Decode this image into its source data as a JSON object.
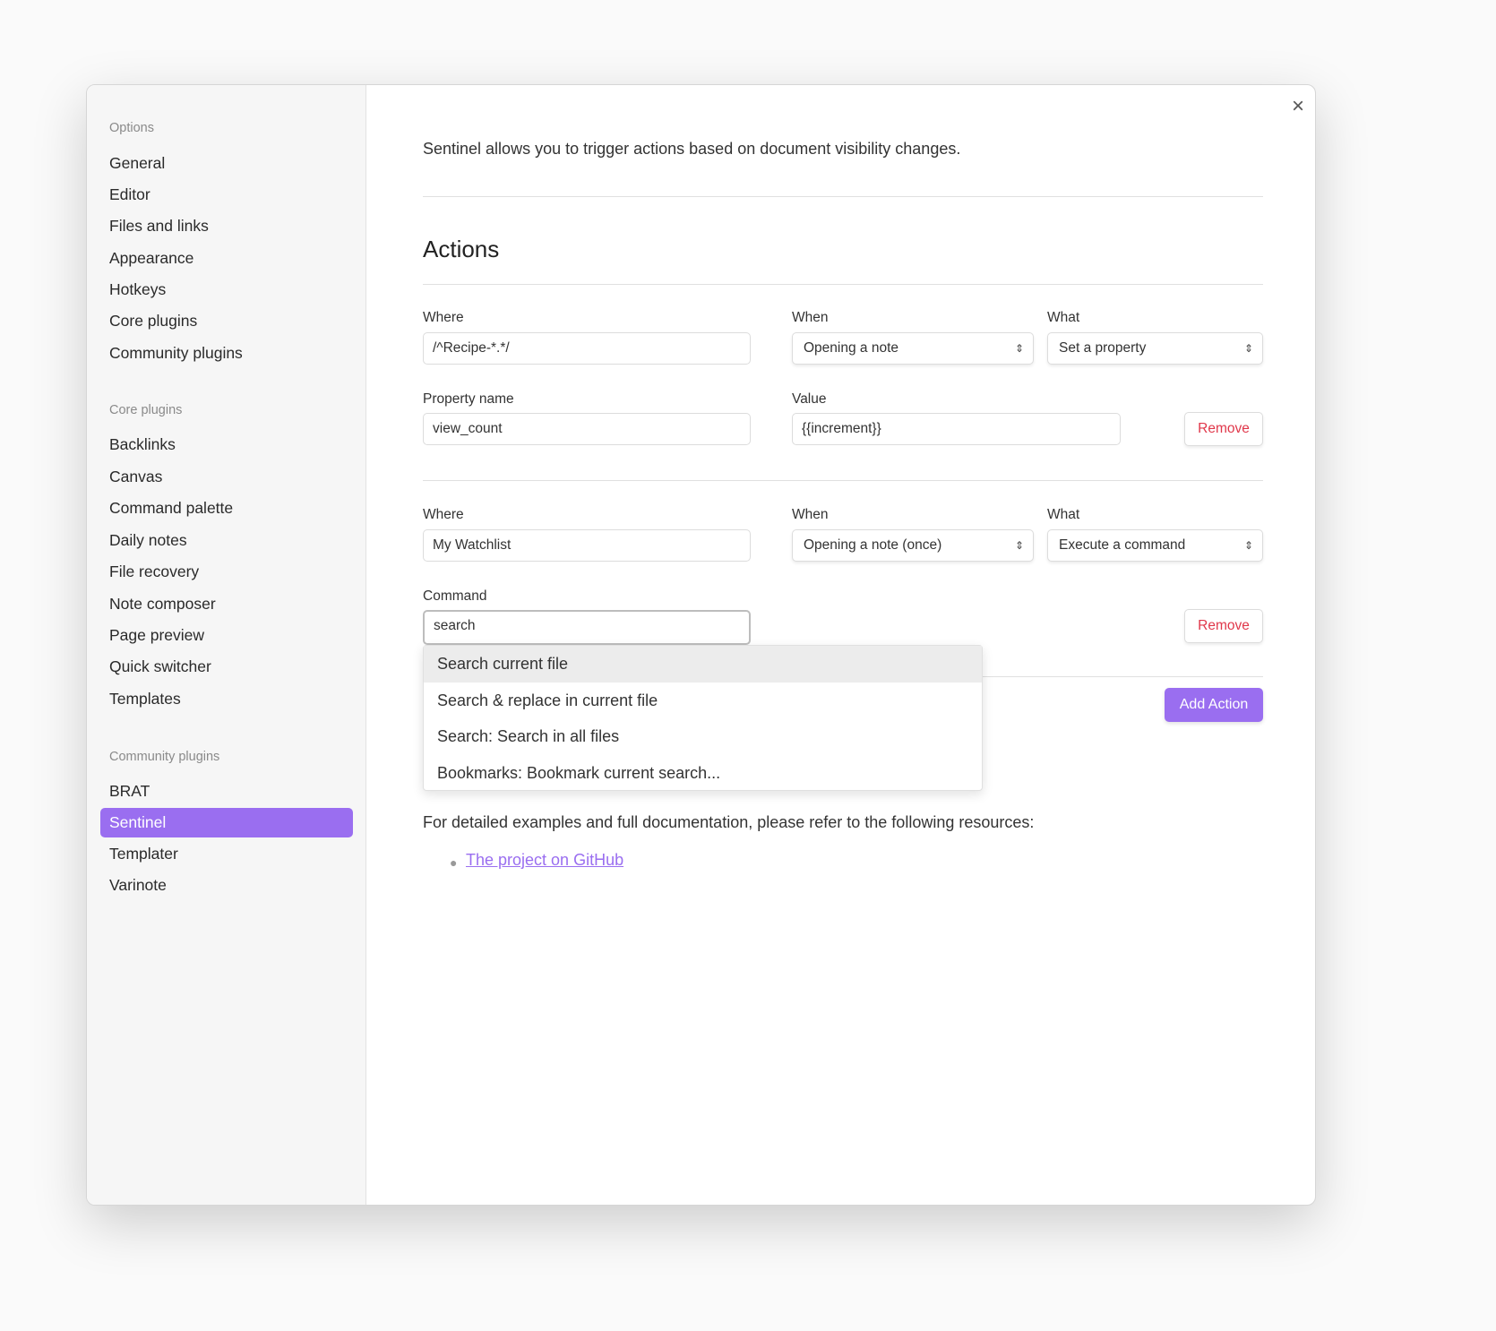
{
  "sidebar": {
    "sections": [
      {
        "header": "Options",
        "items": [
          "General",
          "Editor",
          "Files and links",
          "Appearance",
          "Hotkeys",
          "Core plugins",
          "Community plugins"
        ]
      },
      {
        "header": "Core plugins",
        "items": [
          "Backlinks",
          "Canvas",
          "Command palette",
          "Daily notes",
          "File recovery",
          "Note composer",
          "Page preview",
          "Quick switcher",
          "Templates"
        ]
      },
      {
        "header": "Community plugins",
        "items": [
          "BRAT",
          "Sentinel",
          "Templater",
          "Varinote"
        ]
      }
    ],
    "active": "Sentinel"
  },
  "main": {
    "intro": "Sentinel allows you to trigger actions based on document visibility changes.",
    "heading": "Actions",
    "actions": [
      {
        "where_label": "Where",
        "where": "/^Recipe-*.*/",
        "when_label": "When",
        "when": "Opening a note",
        "what_label": "What",
        "what": "Set a property",
        "field1_label": "Property name",
        "field1": "view_count",
        "field2_label": "Value",
        "field2": "{{increment}}",
        "remove": "Remove"
      },
      {
        "where_label": "Where",
        "where": "My Watchlist",
        "when_label": "When",
        "when": "Opening a note (once)",
        "what_label": "What",
        "what": "Execute a command",
        "field1_label": "Command",
        "field1": "search",
        "remove": "Remove"
      }
    ],
    "suggestions": [
      "Search current file",
      "Search & replace in current file",
      "Search: Search in all files",
      "Bookmarks: Bookmark current search..."
    ],
    "add_action": "Add Action",
    "footer": "For detailed examples and full documentation, please refer to the following resources:",
    "link": "The project on GitHub",
    "close_icon": "×",
    "select_icon": "⇕"
  },
  "colors": {
    "accent": "#9a6ef0",
    "danger": "#e0374a"
  }
}
